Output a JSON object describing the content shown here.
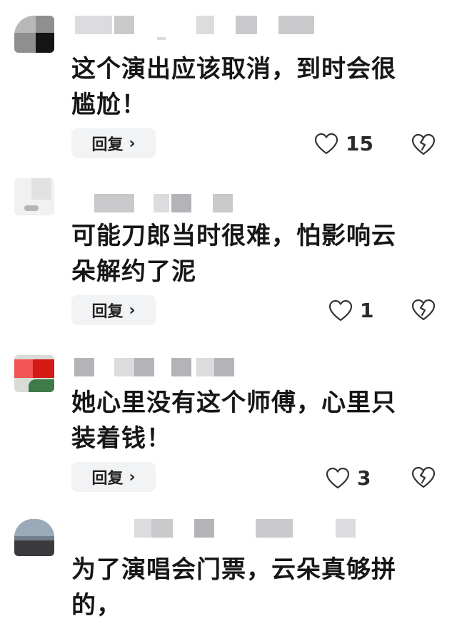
{
  "comments": [
    {
      "text_line1": "这个演出应该取消，到时会很",
      "text_line2": "尴尬！",
      "reply_label": "回复",
      "like_count": "15"
    },
    {
      "text_line1": "可能刀郎当时很难，怕影响云",
      "text_line2": "朵解约了泥",
      "reply_label": "回复",
      "like_count": "1"
    },
    {
      "text_line1": "她心里没有这个师傅，心里只",
      "text_line2": "装着钱！",
      "reply_label": "回复",
      "like_count": "3"
    },
    {
      "text_line1": "为了演唱会门票，云朵真够拼",
      "text_line2": "的，"
    }
  ],
  "icons": {
    "reply_chevron": "chevron-right-icon",
    "like": "heart-outline-icon",
    "dislike": "broken-heart-icon"
  },
  "colors": {
    "reply_bg": "#f2f3f5",
    "icon_stroke": "#333333"
  }
}
